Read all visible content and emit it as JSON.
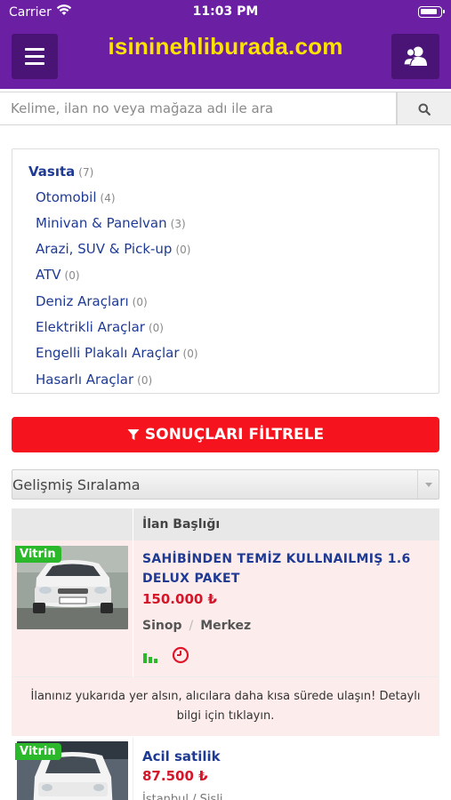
{
  "status_bar": {
    "carrier": "Carrier",
    "time": "11:03 PM"
  },
  "header": {
    "logo": "isininehliburada.com",
    "menu_icon": "hamburger-icon",
    "user_icon": "users-icon"
  },
  "search": {
    "placeholder": "Kelime, ilan no veya mağaza adı ile ara",
    "value": "",
    "icon": "search-icon"
  },
  "categories": {
    "root": {
      "label": "Vasıta",
      "count": "(7)"
    },
    "items": [
      {
        "label": "Otomobil",
        "count": "(4)"
      },
      {
        "label": "Minivan & Panelvan",
        "count": "(3)"
      },
      {
        "label": "Arazi, SUV & Pick-up",
        "count": "(0)"
      },
      {
        "label": "ATV",
        "count": "(0)"
      },
      {
        "label": "Deniz Araçları",
        "count": "(0)"
      },
      {
        "label": "Elektrikli Araçlar",
        "count": "(0)"
      },
      {
        "label": "Engelli Plakalı Araçlar",
        "count": "(0)"
      },
      {
        "label": "Hasarlı Araçlar",
        "count": "(0)"
      }
    ]
  },
  "filter_button": {
    "label": "SONUÇLARI FİLTRELE",
    "icon": "filter-icon",
    "color": "#f5141e"
  },
  "sort": {
    "selected": "Gelişmiş Sıralama"
  },
  "listing_table": {
    "header_title": "İlan Başlığı",
    "rows": [
      {
        "badge": "Vitrin",
        "title_line1": "SAHİBİNDEN TEMİZ KULLNAILMIŞ 1.6",
        "title_line2": "DELUX PAKET",
        "price": "150.000 ₺",
        "city": "Sinop",
        "district": "Merkez",
        "icons": [
          "stats-icon",
          "clock-icon"
        ]
      },
      {
        "badge": "Vitrin",
        "title": "Acil satilik",
        "price": "87.500 ₺",
        "location_partial": "İstanbul  /  Şişli"
      }
    ],
    "promo": {
      "line1": "İlanınız yukarıda yer alsın, alıcılara daha kısa sürede ulaşın! Detaylı",
      "line2": "bilgi için tıklayın."
    }
  },
  "colors": {
    "brand": "#6b1fa3",
    "logo": "#ffe200",
    "link": "#1f3a93",
    "price": "#d4162a",
    "badge": "#2bb82b"
  }
}
